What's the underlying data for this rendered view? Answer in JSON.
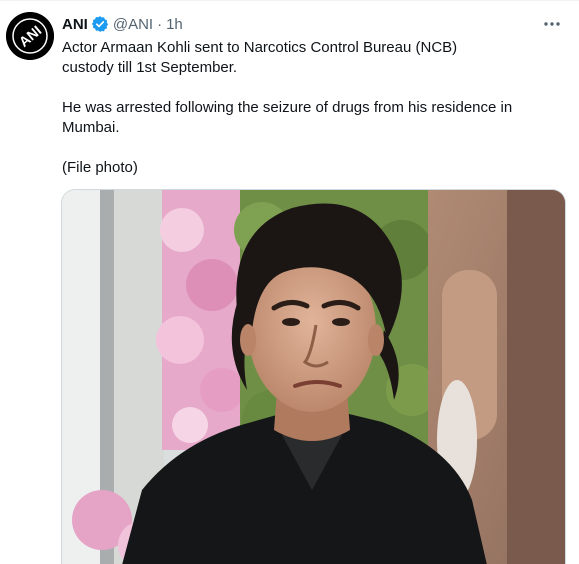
{
  "tweet": {
    "author": {
      "name": "ANI",
      "handle": "@ANI",
      "separator": "·",
      "timestamp": "1h",
      "verified": true,
      "avatar_text": "ANI"
    },
    "paragraphs": [
      "Actor Armaan Kohli sent to Narcotics Control Bureau (NCB)\ncustody till 1st September.",
      "He was arrested following the seizure of drugs from his residence in\nMumbai.",
      "(File photo)"
    ],
    "media": {
      "type": "photo"
    },
    "icons": {
      "verified": "verified-badge-icon",
      "more": "more-options-icon"
    },
    "colors": {
      "verified_blue": "#1d9bf0",
      "secondary_text": "#536471",
      "primary_text": "#0f1419"
    }
  }
}
